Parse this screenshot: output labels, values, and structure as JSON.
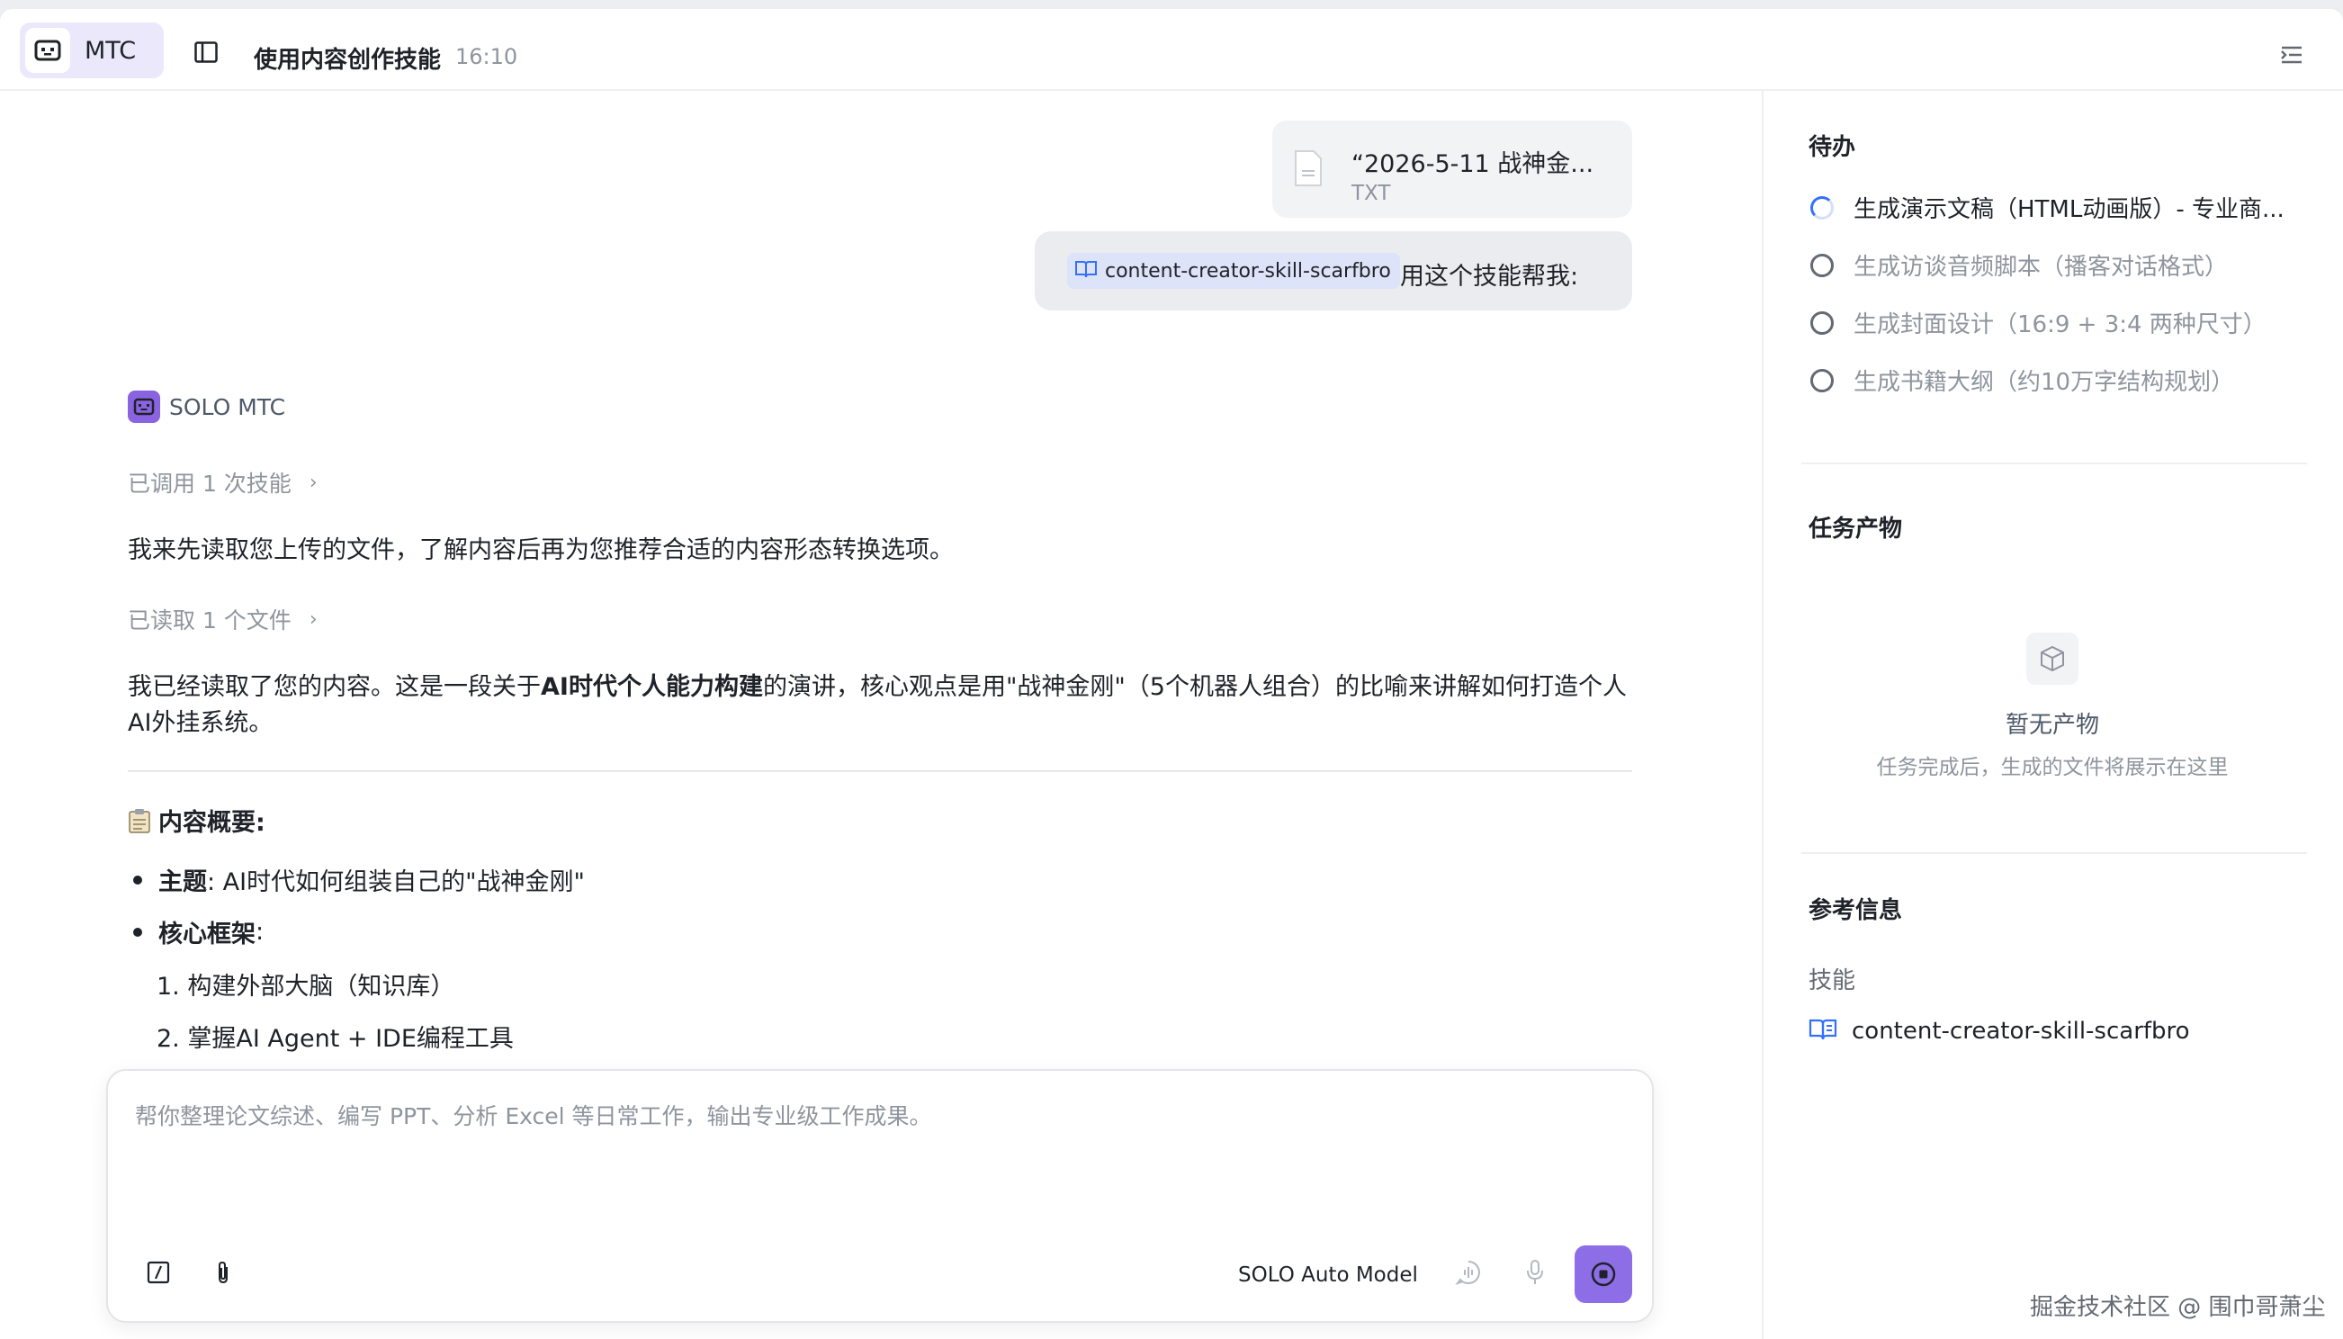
{
  "header": {
    "app_label": "MTC",
    "title": "使用内容创作技能",
    "time": "16:10"
  },
  "chat": {
    "attachment": {
      "name": "“2026-5-11 战神金...",
      "ext": "TXT"
    },
    "user_message": {
      "skill_tag": "content-creator-skill-scarfbro",
      "text": "用这个技能帮我:"
    },
    "bot": {
      "name": "SOLO MTC"
    },
    "skill_status": "已调用 1 次技能",
    "intro": "我来先读取您上传的文件，了解内容后再为您推荐合适的内容形态转换选项。",
    "file_status": "已读取 1 个文件",
    "summary": {
      "before": "我已经读取了您的内容。这是一段关于",
      "bold": "AI时代个人能力构建",
      "after": "的演讲，核心观点是用\"战神金刚\"（5个机器人组合）的比喻来讲解如何打造个人AI外挂系统。"
    },
    "overview_title": "内容概要:",
    "bullets": [
      {
        "label": "主题",
        "text": ": AI时代如何组装自己的\"战神金刚\""
      },
      {
        "label": "核心框架",
        "text": ":"
      }
    ],
    "numbered": [
      "1. 构建外部大脑（知识库）",
      "2. 掌握AI Agent + IDE编程工具"
    ]
  },
  "composer": {
    "placeholder": "帮你整理论文综述、编写 PPT、分析 Excel 等日常工作，输出专业级工作成果。",
    "model": "SOLO Auto Model"
  },
  "right_panel": {
    "todo_title": "待办",
    "todos": [
      {
        "label": "生成演示文稿（HTML动画版）- 专业商...",
        "state": "in_progress"
      },
      {
        "label": "生成访谈音频脚本（播客对话格式）",
        "state": "pending"
      },
      {
        "label": "生成封面设计（16:9 + 3:4 两种尺寸）",
        "state": "pending"
      },
      {
        "label": "生成书籍大纲（约10万字结构规划）",
        "state": "pending"
      }
    ],
    "outputs_title": "任务产物",
    "empty_title": "暂无产物",
    "empty_sub": "任务完成后，生成的文件将展示在这里",
    "ref_title": "参考信息",
    "ref_label": "技能",
    "ref_skill": "content-creator-skill-scarfbro"
  },
  "watermark": "掘金技术社区 @ 围巾哥萧尘",
  "colors": {
    "accent": "#8e6ee6",
    "accent_light": "#ece8fb",
    "spinner": "#3370ff",
    "muted_text": "#8f959e"
  }
}
